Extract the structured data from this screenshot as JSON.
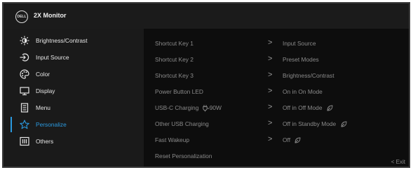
{
  "header": {
    "logo_text": "DELL",
    "title": "2X Monitor"
  },
  "sidebar": {
    "items": [
      {
        "label": "Brightness/Contrast",
        "icon": "brightness-icon"
      },
      {
        "label": "Input Source",
        "icon": "input-source-icon"
      },
      {
        "label": "Color",
        "icon": "color-palette-icon"
      },
      {
        "label": "Display",
        "icon": "display-icon"
      },
      {
        "label": "Menu",
        "icon": "menu-icon"
      },
      {
        "label": "Personalize",
        "icon": "star-icon",
        "active": true
      },
      {
        "label": "Others",
        "icon": "others-icon"
      }
    ],
    "active_color": "#2b9ae0"
  },
  "main": {
    "rows": [
      {
        "label": "Shortcut Key 1",
        "arrow": ">",
        "value": "Input Source"
      },
      {
        "label": "Shortcut Key 2",
        "arrow": ">",
        "value": "Preset Modes"
      },
      {
        "label": "Shortcut Key 3",
        "arrow": ">",
        "value": "Brightness/Contrast"
      },
      {
        "label": "Power Button LED",
        "arrow": ">",
        "value": "On in On Mode"
      },
      {
        "label": "USB-C Charging",
        "label_suffix": "90W",
        "arrow": ">",
        "value": "Off in Off Mode"
      },
      {
        "label": "Other USB Charging",
        "arrow": ">",
        "value": "Off in Standby Mode"
      },
      {
        "label": "Fast Wakeup",
        "arrow": ">",
        "value": "Off"
      },
      {
        "label": "Reset Personalization"
      }
    ]
  },
  "footer": {
    "exit_label": "< Exit"
  }
}
